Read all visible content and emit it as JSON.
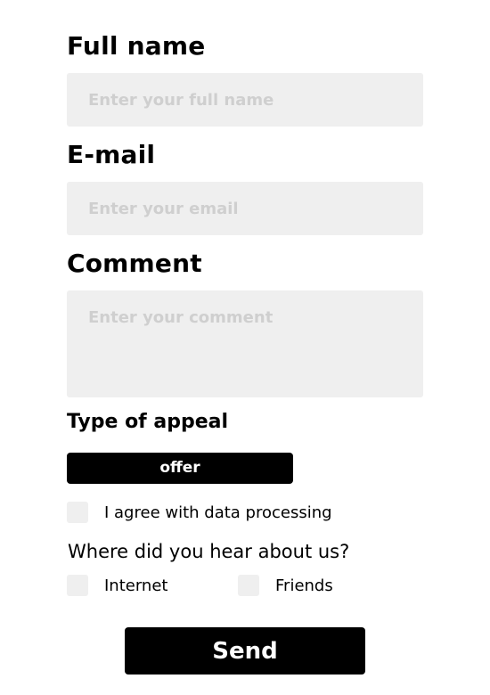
{
  "form": {
    "full_name": {
      "label": "Full name",
      "placeholder": "Enter your full name",
      "value": ""
    },
    "email": {
      "label": "E-mail",
      "placeholder": "Enter your email",
      "value": ""
    },
    "comment": {
      "label": "Comment",
      "placeholder": "Enter your comment",
      "value": ""
    },
    "appeal": {
      "label": "Type of appeal",
      "selected": "offer"
    },
    "agree": {
      "label": "I agree with data processing",
      "checked": false
    },
    "source": {
      "question": "Where did you hear about us?",
      "options": [
        {
          "label": "Internet",
          "checked": false
        },
        {
          "label": "Friends",
          "checked": false
        }
      ]
    },
    "submit_label": "Send"
  },
  "colors": {
    "field_bg": "#efefef",
    "placeholder": "#cfcfcf",
    "button_bg": "#000000",
    "button_text": "#ffffff"
  },
  "icons": {
    "checkbox": "empty-checkbox-square"
  }
}
